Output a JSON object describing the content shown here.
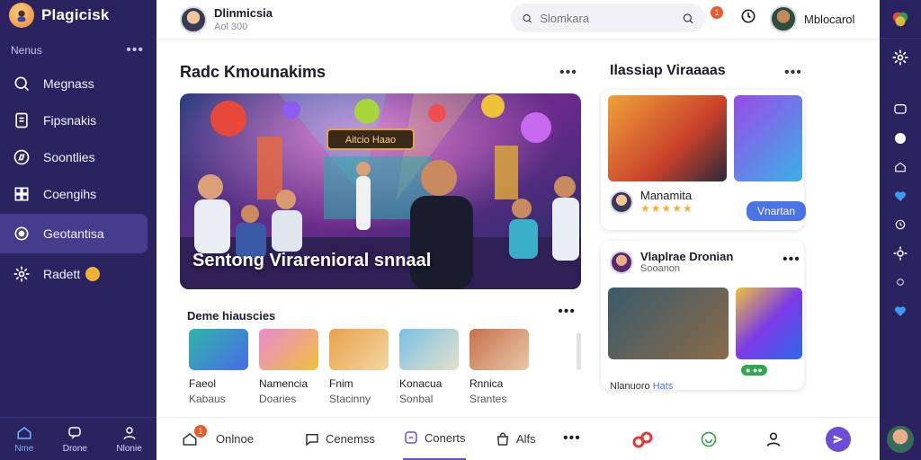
{
  "app": {
    "title": "Plagicisk"
  },
  "sidebar": {
    "menu_label": "Nenus",
    "items": [
      {
        "label": "Megnass",
        "icon": "search-icon"
      },
      {
        "label": "Fipsnakis",
        "icon": "document-icon"
      },
      {
        "label": "Soontlies",
        "icon": "explore-icon"
      },
      {
        "label": "Coengihs",
        "icon": "grid-icon"
      },
      {
        "label": "Geotantisa",
        "icon": "target-icon",
        "active": true
      },
      {
        "label": "Radett",
        "icon": "gear-icon"
      }
    ],
    "bottom_tabs": [
      {
        "label": "Nme",
        "icon": "home-icon",
        "active": true
      },
      {
        "label": "Drone",
        "icon": "chat-icon"
      },
      {
        "label": "Nlonie",
        "icon": "profile-icon"
      }
    ]
  },
  "header": {
    "page_name": "Dlinmicsia",
    "page_sub": "Aol 300",
    "search_placeholder": "Slomkara",
    "notif_count": "1",
    "user_name": "Mblocarol"
  },
  "main": {
    "featured_title": "Radc Kmounakims",
    "hero_sign": "Aitcio Haao",
    "hero_caption": "Sentong Virarenioral snnaal",
    "episodes": {
      "title": "Deme hiauscies",
      "items": [
        {
          "line1": "Faeol",
          "line2": "Kabaus"
        },
        {
          "line1": "Namencia",
          "line2": "Doaries"
        },
        {
          "line1": "Fnim",
          "line2": "Stacinny"
        },
        {
          "line1": "Konacua",
          "line2": "Sonbal"
        },
        {
          "line1": "Rnnica",
          "line2": "Srantes"
        }
      ]
    },
    "side": {
      "title": "Ilassiap Viraaaas",
      "card1": {
        "name": "Manamita",
        "stars": "★★★★★",
        "action": "Vnartan"
      },
      "card2": {
        "name": "Vlaplrae Dronian",
        "sub": "Sooanon",
        "footer_a": "Nlanuoro",
        "footer_b": "Hats"
      }
    }
  },
  "bottombar": {
    "badge": "1",
    "tabs": [
      {
        "label": "Onlnoe",
        "icon": "home-icon"
      },
      {
        "label": "Cenemss",
        "icon": "message-icon"
      },
      {
        "label": "Conerts",
        "icon": "concert-icon",
        "active": true
      },
      {
        "label": "Alfs",
        "icon": "bag-icon"
      }
    ]
  },
  "colors": {
    "sidebar": "#2b2360",
    "active": "#463c8e",
    "accent": "#6a4fd6",
    "star": "#f0b232",
    "notif": "#ef5a2b"
  }
}
